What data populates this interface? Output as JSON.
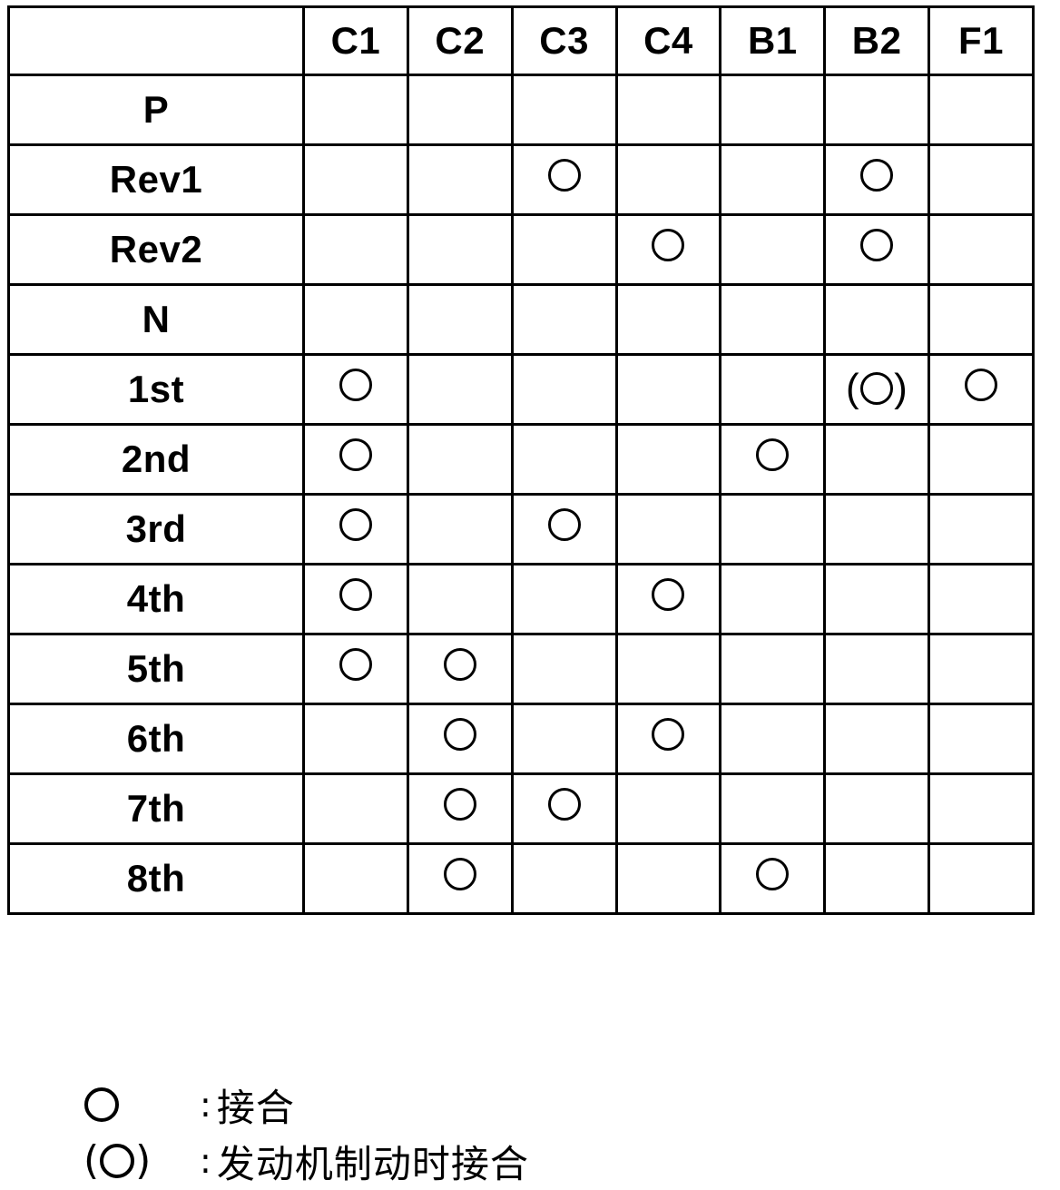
{
  "table": {
    "corner_label": "",
    "columns": [
      "C1",
      "C2",
      "C3",
      "C4",
      "B1",
      "B2",
      "F1"
    ],
    "rows": [
      {
        "label": "P",
        "cells": [
          "",
          "",
          "",
          "",
          "",
          "",
          ""
        ]
      },
      {
        "label": "Rev1",
        "cells": [
          "",
          "",
          "O",
          "",
          "",
          "O",
          ""
        ]
      },
      {
        "label": "Rev2",
        "cells": [
          "",
          "",
          "",
          "O",
          "",
          "O",
          ""
        ]
      },
      {
        "label": "N",
        "cells": [
          "",
          "",
          "",
          "",
          "",
          "",
          ""
        ]
      },
      {
        "label": "1st",
        "cells": [
          "O",
          "",
          "",
          "",
          "",
          "(O)",
          "O"
        ]
      },
      {
        "label": "2nd",
        "cells": [
          "O",
          "",
          "",
          "",
          "O",
          "",
          ""
        ]
      },
      {
        "label": "3rd",
        "cells": [
          "O",
          "",
          "O",
          "",
          "",
          "",
          ""
        ]
      },
      {
        "label": "4th",
        "cells": [
          "O",
          "",
          "",
          "O",
          "",
          "",
          ""
        ]
      },
      {
        "label": "5th",
        "cells": [
          "O",
          "O",
          "",
          "",
          "",
          "",
          ""
        ]
      },
      {
        "label": "6th",
        "cells": [
          "",
          "O",
          "",
          "O",
          "",
          "",
          ""
        ]
      },
      {
        "label": "7th",
        "cells": [
          "",
          "O",
          "O",
          "",
          "",
          "",
          ""
        ]
      },
      {
        "label": "8th",
        "cells": [
          "",
          "O",
          "",
          "",
          "O",
          "",
          ""
        ]
      }
    ]
  },
  "legend": [
    {
      "mark": "O",
      "separator": ":",
      "text": "接合"
    },
    {
      "mark": "(O)",
      "separator": ":",
      "text": "发动机制动时接合"
    }
  ]
}
